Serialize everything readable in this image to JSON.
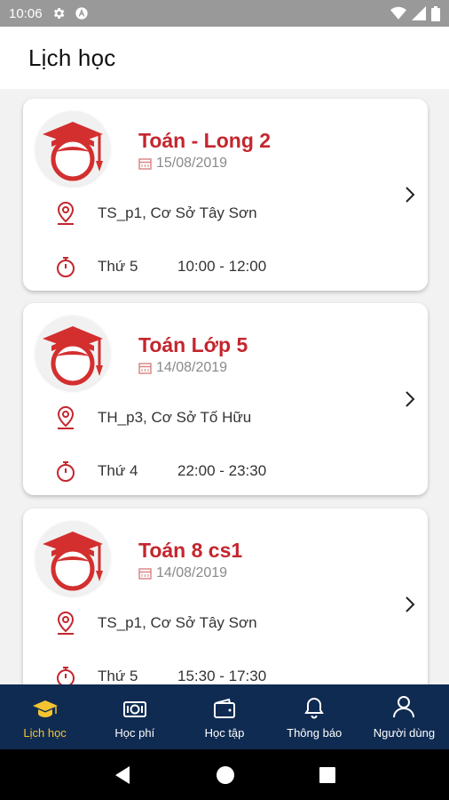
{
  "status_bar": {
    "time": "10:06",
    "icons": [
      "settings-icon",
      "a-badge-icon",
      "wifi-icon",
      "signal-icon",
      "battery-icon"
    ]
  },
  "header": {
    "title": "Lịch học"
  },
  "colors": {
    "accent": "#c4262e",
    "nav_bg": "#0f2b52",
    "nav_active": "#f4c430"
  },
  "schedule": [
    {
      "title": "Toán - Long 2",
      "date": "15/08/2019",
      "location": "TS_p1, Cơ Sở Tây Sơn",
      "day": "Thứ 5",
      "time": "10:00 - 12:00"
    },
    {
      "title": "Toán Lớp 5",
      "date": "14/08/2019",
      "location": "TH_p3, Cơ Sở Tố Hữu",
      "day": "Thứ 4",
      "time": "22:00 - 23:30"
    },
    {
      "title": "Toán 8 cs1",
      "date": "14/08/2019",
      "location": "TS_p1, Cơ Sở Tây Sơn",
      "day": "Thứ 5",
      "time": "15:30 - 17:30"
    }
  ],
  "bottom_nav": [
    {
      "label": "Lịch học",
      "icon": "graduation-cap-icon",
      "active": true
    },
    {
      "label": "Học phí",
      "icon": "money-icon",
      "active": false
    },
    {
      "label": "Học tập",
      "icon": "wallet-icon",
      "active": false
    },
    {
      "label": "Thông báo",
      "icon": "bell-icon",
      "active": false
    },
    {
      "label": "Người dùng",
      "icon": "user-icon",
      "active": false
    }
  ]
}
